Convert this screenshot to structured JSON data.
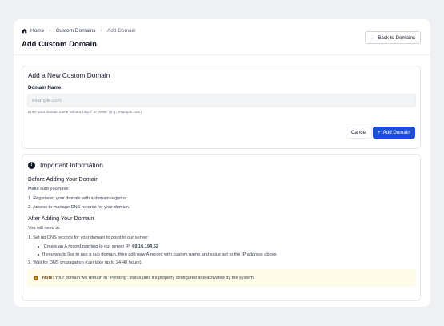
{
  "breadcrumb": {
    "items": [
      "Home",
      "Custom Domains",
      "Add Domain"
    ]
  },
  "header": {
    "title": "Add Custom Domain",
    "back_label": "Back to Domains",
    "back_icon": "arrow-left-icon"
  },
  "form": {
    "title": "Add a New Custom Domain",
    "field_label": "Domain Name",
    "input_value": "",
    "input_placeholder": "example.com",
    "help": "Enter your domain name without 'http://' or 'www.' (e.g., example.com)",
    "cancel_label": "Cancel",
    "submit_label": "Add Domain",
    "submit_icon": "plus-icon",
    "accent": "#1d4ed8"
  },
  "info": {
    "title": "Important Information",
    "before": {
      "heading": "Before Adding Your Domain",
      "intro": "Make sure you have:",
      "items": [
        "1. Registered your domain with a domain registrar.",
        "2. Access to manage DNS records for your domain."
      ]
    },
    "after": {
      "heading": "After Adding Your Domain",
      "intro": "You will need to:",
      "step1": "1. Set up DNS records for your domain to point to our server:",
      "sub1_prefix": "Create an A record pointing to our server IP:",
      "sub1_ip": "69.16.194.52",
      "sub2": "If you would like to use a sub domain, then add new A record with custom name and value set to the IP address above.",
      "step2": "2. Wait for DNS propagation (can take up to 24-48 hours)."
    },
    "note": {
      "label": "Note:",
      "text": "Your domain will remain in \"Pending\" status until it's properly configured and activated by the system.",
      "color": "#fefce8"
    }
  }
}
